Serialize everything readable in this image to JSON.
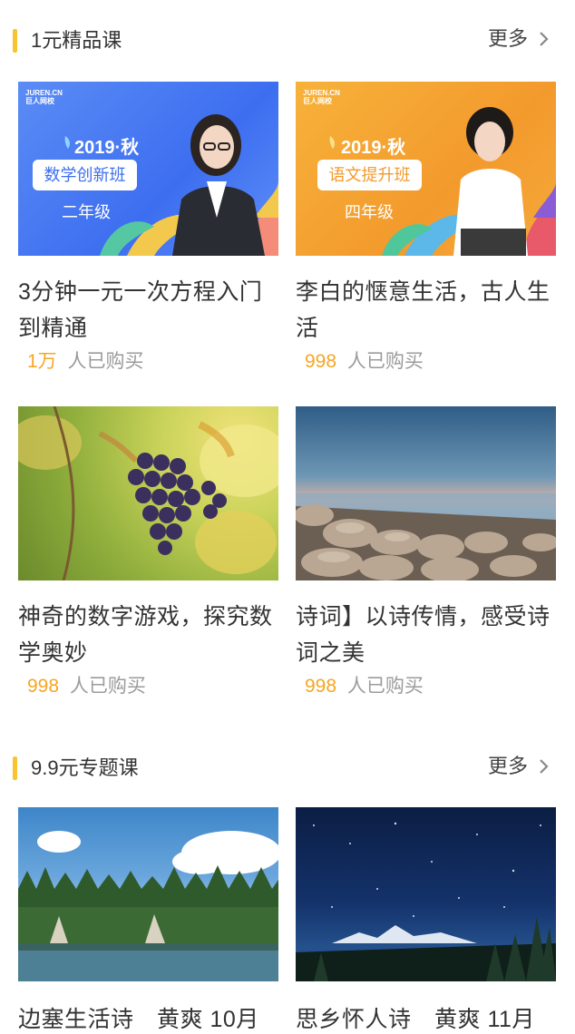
{
  "sections": [
    {
      "title": "1元精品课",
      "more_label": "更多",
      "courses": [
        {
          "title": "3分钟一元一次方程入门到精通",
          "count": "1万",
          "buy_label": "人已购买",
          "banner": {
            "logo": "JUREN.CN\n巨人网校",
            "year": "2019·秋",
            "label": "数学创新班",
            "grade": "二年级"
          }
        },
        {
          "title": "李白的惬意生活，古人生活",
          "count": "998",
          "buy_label": "人已购买",
          "banner": {
            "logo": "JUREN.CN\n巨人网校",
            "year": "2019·秋",
            "label": "语文提升班",
            "grade": "四年级"
          }
        },
        {
          "title": "神奇的数字游戏，探究数学奥妙",
          "count": "998",
          "buy_label": "人已购买"
        },
        {
          "title": "诗词】以诗传情，感受诗词之美",
          "count": "998",
          "buy_label": "人已购买"
        }
      ]
    },
    {
      "title": "9.9元专题课",
      "more_label": "更多",
      "courses": [
        {
          "title": "边塞生活诗　黄爽 10月"
        },
        {
          "title": "思乡怀人诗　黄爽 11月"
        }
      ]
    }
  ],
  "colors": {
    "accent": "#f7c531",
    "count": "#f5a623",
    "muted": "#9b9b9b"
  }
}
